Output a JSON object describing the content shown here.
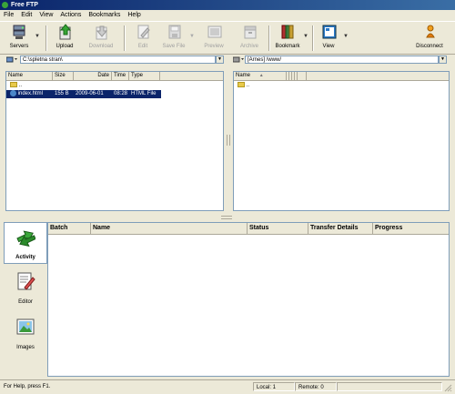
{
  "window": {
    "title": "Free FTP"
  },
  "menu": [
    "File",
    "Edit",
    "View",
    "Actions",
    "Bookmarks",
    "Help"
  ],
  "toolbar": {
    "servers": "Servers",
    "upload": "Upload",
    "download": "Download",
    "edit": "Edit",
    "save_file": "Save File",
    "preview": "Preview",
    "archive": "Archive",
    "bookmark": "Bookmark",
    "view": "View",
    "disconnect": "Disconnect",
    "dropdown_glyph": "▼"
  },
  "local": {
    "path": "C:\\spletna stran\\",
    "columns": [
      "Name",
      "Size",
      "Date",
      "Time",
      "Type"
    ],
    "rows": [
      {
        "name": "..",
        "size": "",
        "date": "",
        "time": "",
        "type": ""
      },
      {
        "name": "index.html",
        "size": "155 B",
        "date": "2009-06-01",
        "time": "08:28",
        "type": "HTML File"
      }
    ]
  },
  "remote": {
    "path": "[Arnes] /www/",
    "columns": [
      "Name"
    ],
    "sort_glyph": "▲",
    "rows": [
      {
        "name": ".."
      }
    ]
  },
  "side_panel": [
    "Activity",
    "Editor",
    "Images"
  ],
  "activity": {
    "columns": [
      "Batch",
      "Name",
      "Status",
      "Transfer Details",
      "Progress"
    ]
  },
  "statusbar": {
    "help": "For Help, press F1.",
    "local": "Local: 1",
    "remote": "Remote: 0"
  },
  "colors": {
    "title_bar": "#0a246a",
    "selection": "#0a246a",
    "window_bg": "#ece9d8"
  }
}
